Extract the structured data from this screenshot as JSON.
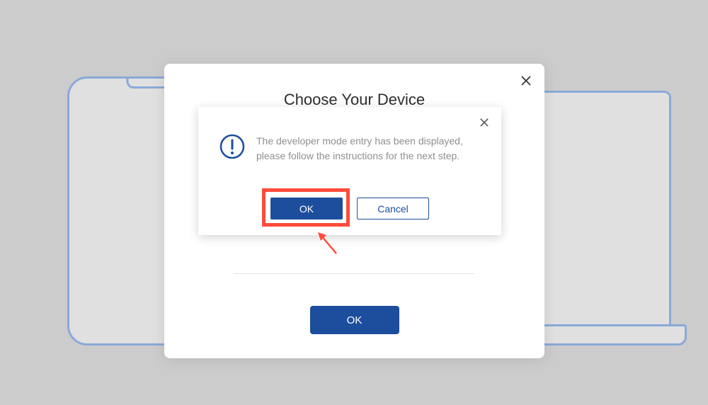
{
  "background": {
    "phone_device": "phone",
    "laptop_device": "laptop"
  },
  "modal": {
    "title": "Choose Your Device",
    "ok_label": "OK"
  },
  "popup": {
    "message": "The developer mode entry has been displayed, please follow the instructions for the next step.",
    "ok_label": "OK",
    "cancel_label": "Cancel"
  },
  "colors": {
    "primary": "#1c4e9d",
    "outline": "#8aa9d8",
    "highlight": "#ff4b3a",
    "text_muted": "#8f8f8f"
  }
}
